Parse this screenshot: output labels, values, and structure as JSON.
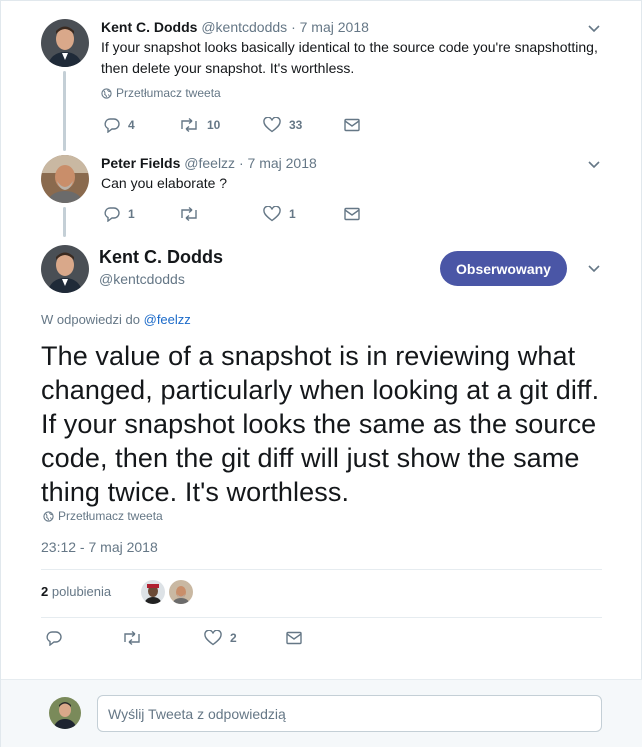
{
  "reply1": {
    "name": "Kent C. Dodds",
    "handle": "@kentcdodds",
    "separator": "·",
    "date": "7 maj 2018",
    "text": "If your snapshot looks basically identical to the source code you're snapshotting, then delete your snapshot. It's worthless.",
    "translate": "Przetłumacz tweeta",
    "replies": "4",
    "retweets": "10",
    "likes": "33"
  },
  "reply2": {
    "name": "Peter Fields",
    "handle": "@feelzz",
    "separator": "·",
    "date": "7 maj 2018",
    "text": "Can you elaborate ?",
    "replies": "1",
    "retweets": "",
    "likes": "1"
  },
  "main": {
    "name": "Kent C. Dodds",
    "handle": "@kentcdodds",
    "follow_label": "Obserwowany",
    "reply_prefix": "W odpowiedzi do",
    "reply_handle": "@feelzz",
    "text": "The value of a snapshot is in reviewing what changed, particularly when looking at a git diff. If your snapshot looks the same as the source code, then the git diff will just show the same thing twice. It's worthless.",
    "translate": "Przetłumacz tweeta",
    "timestamp": "23:12 - 7 maj 2018",
    "likes_count": "2",
    "likes_label": "polubienia",
    "replies": "",
    "retweets": "",
    "likes": "2"
  },
  "composer": {
    "placeholder": "Wyślij Tweeta z odpowiedzią"
  },
  "colors": {
    "accent": "#4a56a6",
    "link": "#1b6ac9",
    "muted": "#657786",
    "thread": "#c4cfd6"
  }
}
